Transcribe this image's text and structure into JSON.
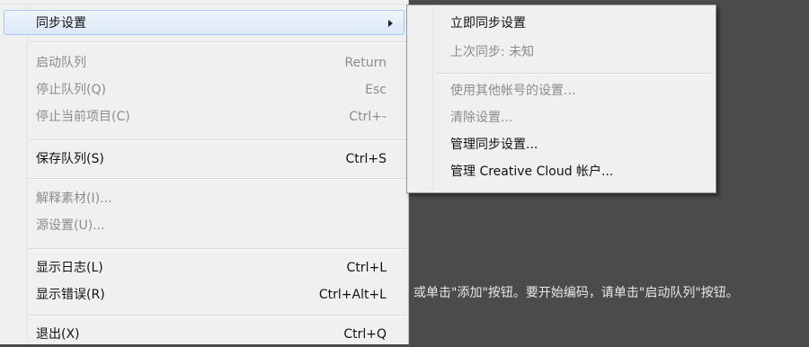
{
  "background_hint": "或单击\"添加\"按钮。要开始编码，请单击\"启动队列\"按钮。",
  "menu": {
    "items": [
      {
        "label": "同步设置",
        "accel": "",
        "state": "hover",
        "has_submenu": true
      },
      {
        "label": "启动队列",
        "accel": "Return",
        "state": "disabled"
      },
      {
        "label": "停止队列(Q)",
        "accel": "Esc",
        "state": "disabled"
      },
      {
        "label": "停止当前项目(C)",
        "accel": "Ctrl+-",
        "state": "disabled"
      },
      {
        "label": "保存队列(S)",
        "accel": "Ctrl+S",
        "state": "enabled"
      },
      {
        "label": "解释素材(I)...",
        "accel": "",
        "state": "disabled"
      },
      {
        "label": "源设置(U)...",
        "accel": "",
        "state": "disabled"
      },
      {
        "label": "显示日志(L)",
        "accel": "Ctrl+L",
        "state": "enabled"
      },
      {
        "label": "显示错误(R)",
        "accel": "Ctrl+Alt+L",
        "state": "enabled"
      },
      {
        "label": "退出(X)",
        "accel": "Ctrl+Q",
        "state": "enabled"
      }
    ]
  },
  "submenu": {
    "items": [
      {
        "label": "立即同步设置",
        "state": "enabled"
      },
      {
        "label": "上次同步: 未知",
        "state": "disabled"
      },
      {
        "label": "使用其他帐号的设置...",
        "state": "disabled"
      },
      {
        "label": "清除设置...",
        "state": "disabled"
      },
      {
        "label": "管理同步设置...",
        "state": "enabled"
      },
      {
        "label": "管理 Creative Cloud 帐户...",
        "state": "enabled"
      }
    ]
  }
}
